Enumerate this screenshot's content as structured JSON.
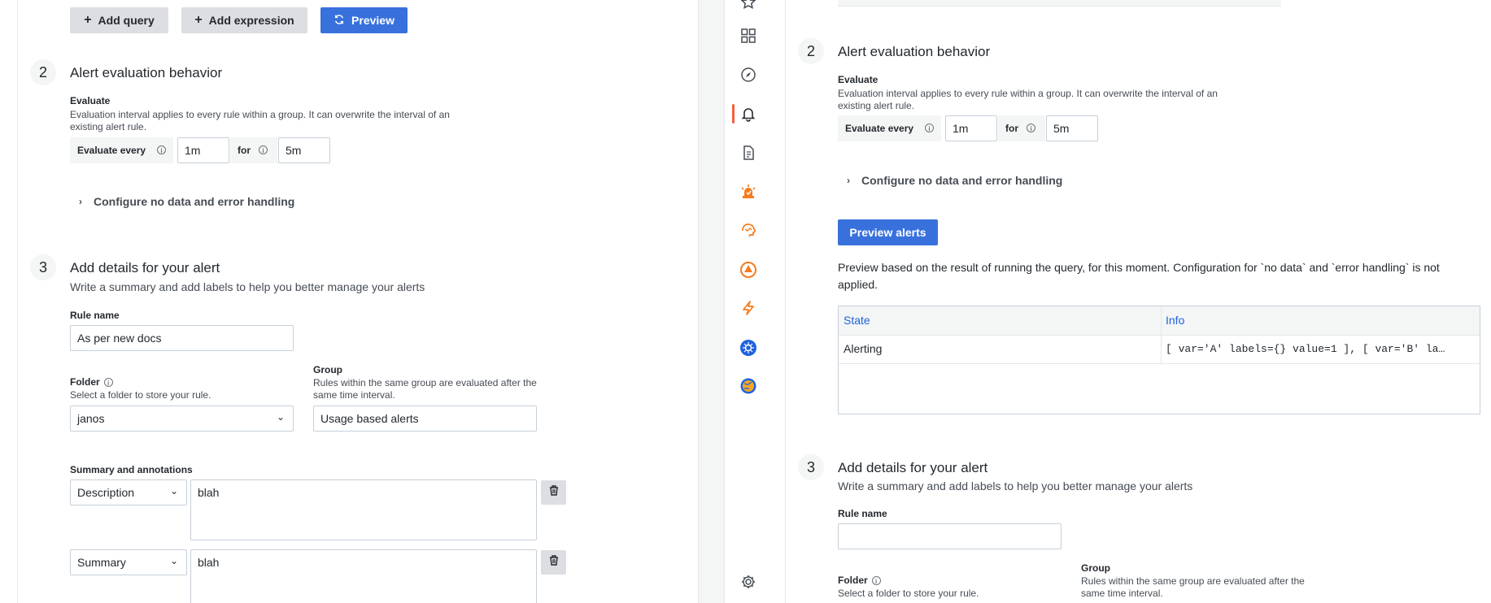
{
  "left": {
    "toolbar": {
      "add_query": "Add query",
      "add_expression": "Add expression",
      "preview": "Preview"
    },
    "section2": {
      "num": "2",
      "title": "Alert evaluation behavior",
      "evaluate_label": "Evaluate",
      "evaluate_desc": "Evaluation interval applies to every rule within a group. It can overwrite the interval of an existing alert rule.",
      "evaluate_every": "Evaluate every",
      "every_value": "1m",
      "for_label": "for",
      "for_value": "5m",
      "configure": "Configure no data and error handling"
    },
    "section3": {
      "num": "3",
      "title": "Add details for your alert",
      "subtitle": "Write a summary and add labels to help you better manage your alerts",
      "rule_name_label": "Rule name",
      "rule_name_value": "As per new docs",
      "folder_label": "Folder",
      "folder_desc": "Select a folder to store your rule.",
      "folder_value": "janos",
      "group_label": "Group",
      "group_desc": "Rules within the same group are evaluated after the same time interval.",
      "group_value": "Usage based alerts",
      "annotations_label": "Summary and annotations",
      "annotations": [
        {
          "key": "Description",
          "value": "blah"
        },
        {
          "key": "Summary",
          "value": "blah"
        }
      ]
    }
  },
  "right": {
    "section2": {
      "num": "2",
      "title": "Alert evaluation behavior",
      "evaluate_label": "Evaluate",
      "evaluate_desc": "Evaluation interval applies to every rule within a group. It can overwrite the interval of an existing alert rule.",
      "evaluate_every": "Evaluate every",
      "every_value": "1m",
      "for_label": "for",
      "for_value": "5m",
      "configure": "Configure no data and error handling",
      "preview_alerts": "Preview alerts",
      "preview_desc": "Preview based on the result of running the query, for this moment. Configuration for `no data` and `error handling` is not applied.",
      "table": {
        "headers": [
          "State",
          "Info"
        ],
        "rows": [
          {
            "state": "Alerting",
            "info": "[ var='A' labels={} value=1 ], [ var='B' la…"
          }
        ]
      }
    },
    "section3": {
      "num": "3",
      "title": "Add details for your alert",
      "subtitle": "Write a summary and add labels to help you better manage your alerts",
      "rule_name_label": "Rule name",
      "rule_name_value": "",
      "folder_label": "Folder",
      "folder_desc": "Select a folder to store your rule.",
      "group_label": "Group",
      "group_desc": "Rules within the same group are evaluated after the same time interval."
    }
  },
  "nav_icons": [
    "star-icon",
    "dashboards-icon",
    "explore-icon",
    "alerting-icon",
    "reports-icon",
    "oncall-icon",
    "ml-icon",
    "incident-icon",
    "k6-icon",
    "kubernetes-icon",
    "geo-icon",
    "settings-icon"
  ],
  "colors": {
    "primary": "#3871dc",
    "link": "#1f62e0",
    "active_nav": "#f55f3e"
  }
}
